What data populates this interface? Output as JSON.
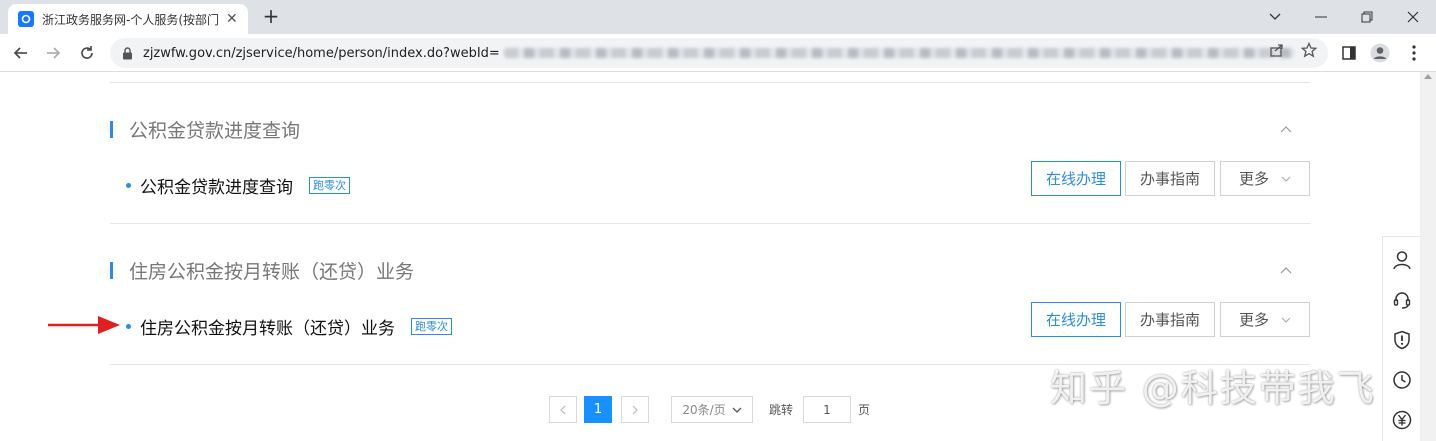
{
  "browser": {
    "tab_title": "浙江政务服务网-个人服务(按部门",
    "url_visible": "zjzwfw.gov.cn/zjservice/home/person/index.do?webId="
  },
  "sections": [
    {
      "title": "公积金贷款进度查询",
      "item": "公积金贷款进度查询",
      "badge": "跑零次",
      "buttons": {
        "online": "在线办理",
        "guide": "办事指南",
        "more": "更多"
      }
    },
    {
      "title": "住房公积金按月转账（还贷）业务",
      "item": "住房公积金按月转账（还贷）业务",
      "badge": "跑零次",
      "buttons": {
        "online": "在线办理",
        "guide": "办事指南",
        "more": "更多"
      }
    }
  ],
  "pagination": {
    "current_page": "1",
    "page_size": "20条/页",
    "jump_label": "跳转",
    "jump_value": "1",
    "page_suffix": "页"
  },
  "watermark": "知乎 @科技带我飞",
  "colors": {
    "accent": "#2b8de0",
    "active_page": "#1890ff",
    "arrow": "#e02020"
  }
}
